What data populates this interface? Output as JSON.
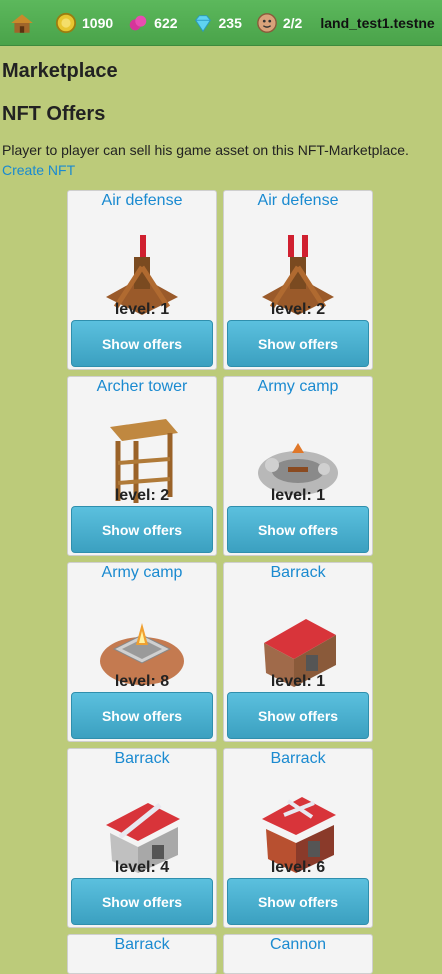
{
  "topbar": {
    "gold": "1090",
    "gems_pink": "622",
    "diamonds": "235",
    "workers": "2/2",
    "land": "land_test1.testne",
    "icons": [
      "hut-icon",
      "gold-coin-icon",
      "pink-gem-icon",
      "diamond-icon",
      "worker-icon"
    ]
  },
  "page": {
    "title": "Marketplace",
    "section_title": "NFT Offers",
    "description": "Player to player can sell his game asset on this NFT-Marketplace.",
    "create_link": "Create NFT"
  },
  "offers": [
    {
      "name": "Air defense",
      "level": "level: 1",
      "button": "Show offers",
      "icon": "air-defense-icon"
    },
    {
      "name": "Air defense",
      "level": "level: 2",
      "button": "Show offers",
      "icon": "air-defense-icon"
    },
    {
      "name": "Archer tower",
      "level": "level: 2",
      "button": "Show offers",
      "icon": "archer-tower-icon"
    },
    {
      "name": "Army camp",
      "level": "level: 1",
      "button": "Show offers",
      "icon": "army-camp-icon"
    },
    {
      "name": "Army camp",
      "level": "level: 8",
      "button": "Show offers",
      "icon": "army-camp-icon"
    },
    {
      "name": "Barrack",
      "level": "level: 1",
      "button": "Show offers",
      "icon": "barrack-icon"
    },
    {
      "name": "Barrack",
      "level": "level: 4",
      "button": "Show offers",
      "icon": "barrack-icon"
    },
    {
      "name": "Barrack",
      "level": "level: 6",
      "button": "Show offers",
      "icon": "barrack-icon"
    },
    {
      "name": "Barrack",
      "icon": "barrack-icon"
    },
    {
      "name": "Cannon",
      "icon": "cannon-icon"
    }
  ],
  "colors": {
    "topbar": "#4aa34a",
    "background": "#bccb7a",
    "link": "#1a8ad0",
    "button": "#46b0d0"
  }
}
